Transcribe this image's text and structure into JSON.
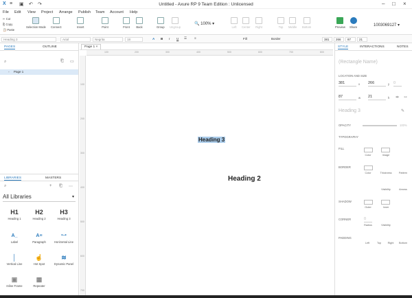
{
  "window": {
    "title": "Untitled - Axure RP 9 Team Edition : Unlicensed"
  },
  "menu": [
    "File",
    "Edit",
    "View",
    "Project",
    "Arrange",
    "Publish",
    "Team",
    "Account",
    "Help"
  ],
  "clipboard": {
    "cut": "Cut",
    "copy": "Copy",
    "paste": "Paste"
  },
  "toolbar": {
    "selection_mode": "Selection Mode",
    "connect": "Connect",
    "insert": "Insert",
    "point": "Point",
    "front": "Front",
    "back": "Back",
    "group": "Group",
    "ungroup": "Ungroup",
    "zoom": "100%",
    "left": "Left",
    "center": "Center",
    "right": "Right",
    "top": "Top",
    "middle": "Middle",
    "bottom": "Bottom",
    "preview": "Preview",
    "share": "Share",
    "account_id": "1003069127"
  },
  "format": {
    "style": "Heading 3",
    "font": "Arial",
    "weight": "Negrita",
    "size": "18",
    "fill_label": "Fill",
    "border_label": "Border",
    "x": "381",
    "y": "266",
    "w": "87",
    "h": "21"
  },
  "left_panel": {
    "tab_pages": "PAGES",
    "tab_outline": "OUTLINE",
    "page1": "Page 1",
    "tab_libraries": "LIBRARIES",
    "tab_masters": "MASTERS",
    "library_select": "All Libraries",
    "items": [
      {
        "glyph": "H1",
        "label": "Heading 1"
      },
      {
        "glyph": "H2",
        "label": "Heading 2"
      },
      {
        "glyph": "H3",
        "label": "Heading 3"
      },
      {
        "glyph": "A_",
        "label": "Label"
      },
      {
        "glyph": "A≡",
        "label": "Paragraph"
      },
      {
        "glyph": "•–•",
        "label": "Horizontal Line"
      },
      {
        "glyph": "│",
        "label": "Vertical Line"
      },
      {
        "glyph": "☝",
        "label": "Hot Spot"
      },
      {
        "glyph": "≋",
        "label": "Dynamic Panel"
      },
      {
        "glyph": "▣",
        "label": "Inline Frame"
      },
      {
        "glyph": "▦",
        "label": "Repeater"
      }
    ]
  },
  "canvas": {
    "tab": "Page 1",
    "heading3": "Heading 3",
    "heading2": "Heading 2",
    "ruler_h": [
      "100",
      "200",
      "300",
      "400",
      "500",
      "600",
      "700",
      "800"
    ],
    "ruler_v": [
      "100",
      "200",
      "300",
      "400",
      "500",
      "600",
      "700"
    ]
  },
  "right_panel": {
    "tab_style": "STYLE",
    "tab_interactions": "INTERACTIONS",
    "tab_notes": "NOTES",
    "name_placeholder": "(Rectangle Name)",
    "location_size": "LOCATION AND SIZE",
    "x": "381",
    "y": "266",
    "w": "87",
    "h": "21",
    "rot": "0",
    "style_name": "Heading 3",
    "opacity_label": "OPACITY",
    "opacity_value": "100%",
    "typography": "TYPOGRAPHY",
    "fill": "FILL",
    "fill_color": "Color",
    "fill_image": "Image",
    "border": "BORDER",
    "border_color": "Color",
    "border_thickness": "Thickness",
    "border_pattern": "Pattern",
    "border_visibility": "Visibility",
    "border_arrows": "Arrows",
    "shadow": "SHADOW",
    "shadow_outer": "Outer",
    "shadow_inner": "Inner",
    "corner": "CORNER",
    "corner_radius": "Radius",
    "corner_visibility": "Visibility",
    "corner_radius_val": "0",
    "padding": "PADDING",
    "pad_left": "Left",
    "pad_top": "Top",
    "pad_right": "Right",
    "pad_bottom": "Bottom"
  }
}
